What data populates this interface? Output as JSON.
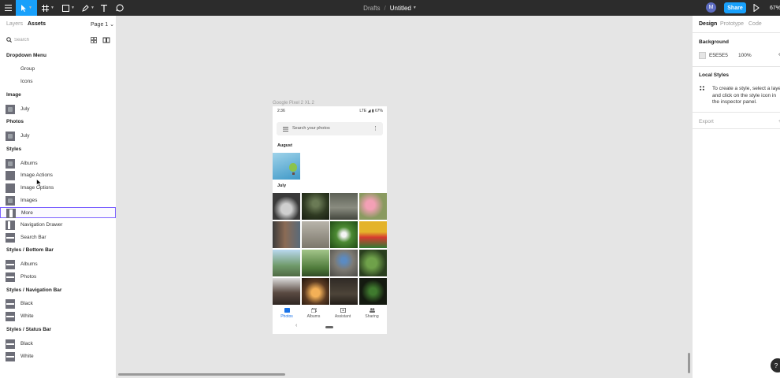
{
  "toolbar": {
    "breadcrumb_parent": "Drafts",
    "breadcrumb_sep": "/",
    "file_title": "Untitled",
    "avatar_initial": "M",
    "share_label": "Share",
    "zoom": "67%"
  },
  "left_panel": {
    "tab_layers": "Layers",
    "tab_assets": "Assets",
    "page_selector": "Page 1",
    "search_placeholder": "Search",
    "sections": [
      {
        "title": "Dropdown Menu",
        "items": [
          "Group",
          "Icons"
        ]
      },
      {
        "title": "Image",
        "items": [
          "July"
        ]
      },
      {
        "title": "Photos",
        "items": [
          "July"
        ]
      },
      {
        "title": "Styles",
        "items": [
          "Albums",
          "Image Actions",
          "Image Options",
          "Images",
          "More",
          "Navigation Drawer",
          "Search Bar"
        ]
      },
      {
        "title": "Styles / Bottom Bar",
        "items": [
          "Albums",
          "Photos"
        ]
      },
      {
        "title": "Styles / Navigation Bar",
        "items": [
          "Black",
          "White"
        ]
      },
      {
        "title": "Styles / Status Bar",
        "items": [
          "Black",
          "White"
        ]
      }
    ]
  },
  "canvas": {
    "frame_label": "Google Pixel 2 XL 2",
    "phone": {
      "time": "2:36",
      "status_right": "LTE ◢ ▮ 67%",
      "search_placeholder": "Search your photos",
      "section_august": "August",
      "section_july": "July",
      "nav": [
        "Photos",
        "Albums",
        "Assistant",
        "Sharing"
      ]
    }
  },
  "right_panel": {
    "tab_design": "Design",
    "tab_prototype": "Prototype",
    "tab_code": "Code",
    "background_title": "Background",
    "background_hex": "E5E5E5",
    "background_opacity": "100%",
    "local_styles_title": "Local Styles",
    "local_styles_help": "To create a style, select a layer and click on the style icon in the inspector panel.",
    "export_title": "Export",
    "help_label": "?"
  },
  "colors": {
    "toolbar_bg": "#2c2c2c",
    "accent": "#18a0fb",
    "selection": "#7b61ff",
    "canvas_bg": "#e5e5e5"
  }
}
